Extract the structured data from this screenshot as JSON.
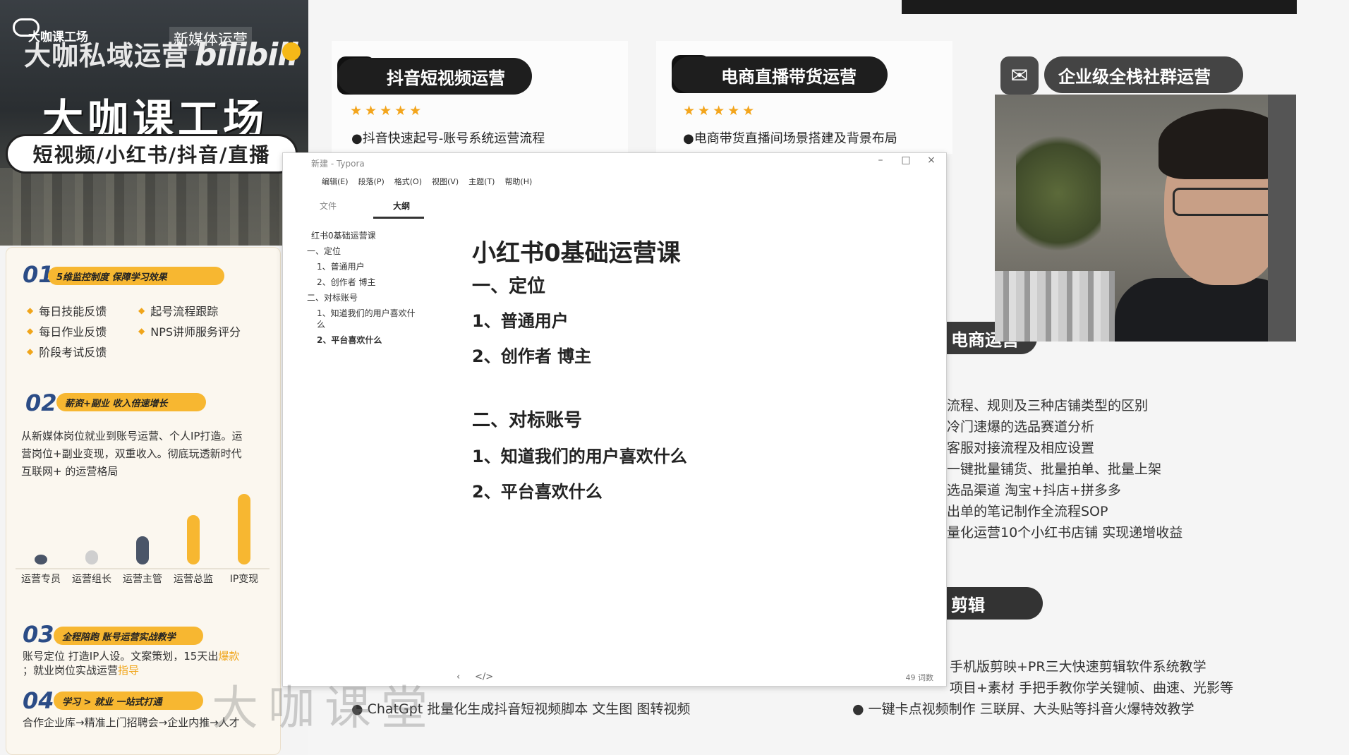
{
  "banner": {
    "logo_text": "大咖课工场",
    "private_domain_title": "大咖私域运营",
    "new_media_caption": "新媒体运营",
    "bili_logo": "bilibili",
    "main_title": "大咖课工场",
    "pill_text": "短视频/小红书/抖音/直播"
  },
  "left_panel": {
    "sections": [
      {
        "num": "01",
        "title": "5维监控制度 保障学习效果"
      },
      {
        "num": "02",
        "title": "薪资+副业 收入倍速增长"
      },
      {
        "num": "03",
        "title": "全程陪跑 账号运营实战教学"
      },
      {
        "num": "04",
        "title": "学习 > 就业 一站式打通"
      }
    ],
    "features": [
      "每日技能反馈",
      "起号流程跟踪",
      "每日作业反馈",
      "NPS讲师服务评分",
      "阶段考试反馈"
    ],
    "para_02_lines": [
      "从新媒体岗位就业到账号运营、个人IP打造。运",
      "营岗位+副业变现，双重收入。彻底玩透新时代",
      "互联网+ 的运营格局"
    ],
    "para_03_line1": "账号定位 打造IP人设。文案策划，15天出",
    "para_03_hl1": "爆款",
    "para_03_line2": "；就业岗位实战运营",
    "para_03_hl2": "指导",
    "para_04_line": "合作企业库→精准上门招聘会→企业内推→人才"
  },
  "chart_data": {
    "type": "bar",
    "categories": [
      "运营专员",
      "运营组长",
      "运营主管",
      "运营总监",
      "IP变现"
    ],
    "values": [
      1,
      2,
      4,
      7,
      10
    ],
    "colors": [
      "#4a5568",
      "#cfcfcf",
      "#4a5568",
      "#f7b731",
      "#f7b731"
    ],
    "ylim": [
      0,
      10
    ]
  },
  "courses": [
    {
      "title": "抖音短视频运营",
      "stars": "★★★★★",
      "line": "●抖音快速起号-账号系统运营流程"
    },
    {
      "title": "电商直播带货运营",
      "stars": "★★★★★",
      "line": "●电商带货直播间场景搭建及背景布局"
    },
    {
      "title": "企业级全栈社群运营"
    }
  ],
  "typora": {
    "title": "新建 - Typora",
    "menu": [
      "编辑(E)",
      "段落(P)",
      "格式(O)",
      "视图(V)",
      "主题(T)",
      "帮助(H)"
    ],
    "tabs": [
      "文件",
      "大纲"
    ],
    "outline": [
      "红书0基础运营课",
      "一、定位",
      "1、普通用户",
      "2、创作者 博主",
      "二、对标账号",
      "1、知道我们的用户喜欢什",
      "么",
      "2、平台喜欢什么"
    ],
    "doc": {
      "h1": "小红书0基础运营课",
      "sec1": "一、定位",
      "sec1_items": [
        "1、普通用户",
        "2、创作者 博主"
      ],
      "sec2": "二、对标账号",
      "sec2_items": [
        "1、知道我们的用户喜欢什么",
        "2、平台喜欢什么"
      ]
    },
    "status_left": "‹",
    "status_code": "</>",
    "word_count": "49 词数"
  },
  "right_blocks": {
    "ecom_ribbon": "电商运营",
    "ecom_lines": [
      "流程、规则及三种店铺类型的区别",
      "冷门速爆的选品赛道分析",
      "客服对接流程及相应设置",
      "一键批量铺货、批量拍单、批量上架",
      "选品渠道 淘宝+抖店+拼多多",
      "出单的笔记制作全流程SOP",
      "量化运营10个小红书店铺 实现递增收益"
    ],
    "edit_ribbon": "剪辑",
    "edit_lines": [
      "手机版剪映+PR三大快速剪辑软件系统教学",
      "项目+素材 手把手教你学关键帧、曲速、光影等",
      "● 一键卡点视频制作 三联屏、大头贴等抖音火爆特效教学"
    ],
    "bottom_left_lines": [
      "● ChatGpt 批量化生成抖音短视频脚本 文生图 图转视频"
    ]
  },
  "watermark": "大咖课堂"
}
